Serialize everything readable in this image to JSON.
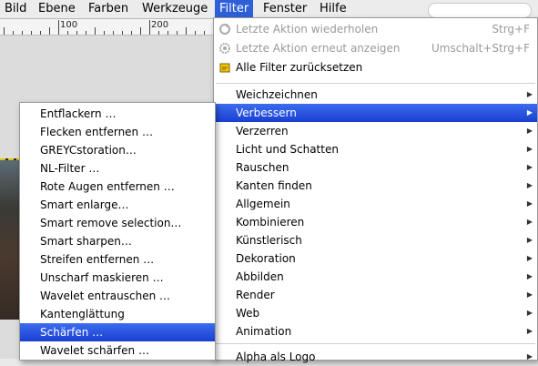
{
  "menubar": {
    "items": [
      {
        "label": "Bild",
        "active": false
      },
      {
        "label": "Ebene",
        "active": false
      },
      {
        "label": "Farben",
        "active": false
      },
      {
        "label": "Werkzeuge",
        "active": false
      },
      {
        "label": "Filter",
        "active": true
      },
      {
        "label": "Fenster",
        "active": false
      },
      {
        "label": "Hilfe",
        "active": false
      }
    ]
  },
  "ruler": {
    "labels": [
      "100",
      "200"
    ]
  },
  "filter_menu": {
    "actions": [
      {
        "label": "Letzte Aktion wiederholen",
        "shortcut": "Strg+F",
        "enabled": false,
        "icon": "repeat-icon"
      },
      {
        "label": "Letzte Aktion erneut anzeigen",
        "shortcut": "Umschalt+Strg+F",
        "enabled": false,
        "icon": "reshow-icon"
      },
      {
        "label": "Alle Filter zurücksetzen",
        "shortcut": "",
        "enabled": true,
        "icon": "reset-icon"
      }
    ],
    "submenus": [
      {
        "label": "Weichzeichnen",
        "selected": false
      },
      {
        "label": "Verbessern",
        "selected": true
      },
      {
        "label": "Verzerren",
        "selected": false
      },
      {
        "label": "Licht und Schatten",
        "selected": false
      },
      {
        "label": "Rauschen",
        "selected": false
      },
      {
        "label": "Kanten finden",
        "selected": false
      },
      {
        "label": "Allgemein",
        "selected": false
      },
      {
        "label": "Kombinieren",
        "selected": false
      },
      {
        "label": "Künstlerisch",
        "selected": false
      },
      {
        "label": "Dekoration",
        "selected": false
      },
      {
        "label": "Abbilden",
        "selected": false
      },
      {
        "label": "Render",
        "selected": false
      },
      {
        "label": "Web",
        "selected": false
      },
      {
        "label": "Animation",
        "selected": false
      }
    ],
    "extra": [
      {
        "label": "Alpha als Logo"
      }
    ]
  },
  "verbessern_menu": {
    "items": [
      {
        "label": "Entflackern …",
        "selected": false
      },
      {
        "label": "Flecken entfernen …",
        "selected": false
      },
      {
        "label": "GREYCstoration…",
        "selected": false
      },
      {
        "label": "NL-Filter …",
        "selected": false
      },
      {
        "label": "Rote Augen entfernen …",
        "selected": false
      },
      {
        "label": "Smart enlarge…",
        "selected": false
      },
      {
        "label": "Smart remove selection…",
        "selected": false
      },
      {
        "label": "Smart sharpen…",
        "selected": false
      },
      {
        "label": "Streifen entfernen …",
        "selected": false
      },
      {
        "label": "Unscharf maskieren …",
        "selected": false
      },
      {
        "label": "Wavelet entrauschen …",
        "selected": false
      },
      {
        "label": "Kantenglättung",
        "selected": false
      },
      {
        "label": "Schärfen …",
        "selected": true
      },
      {
        "label": "Wavelet schärfen …",
        "selected": false
      }
    ]
  }
}
